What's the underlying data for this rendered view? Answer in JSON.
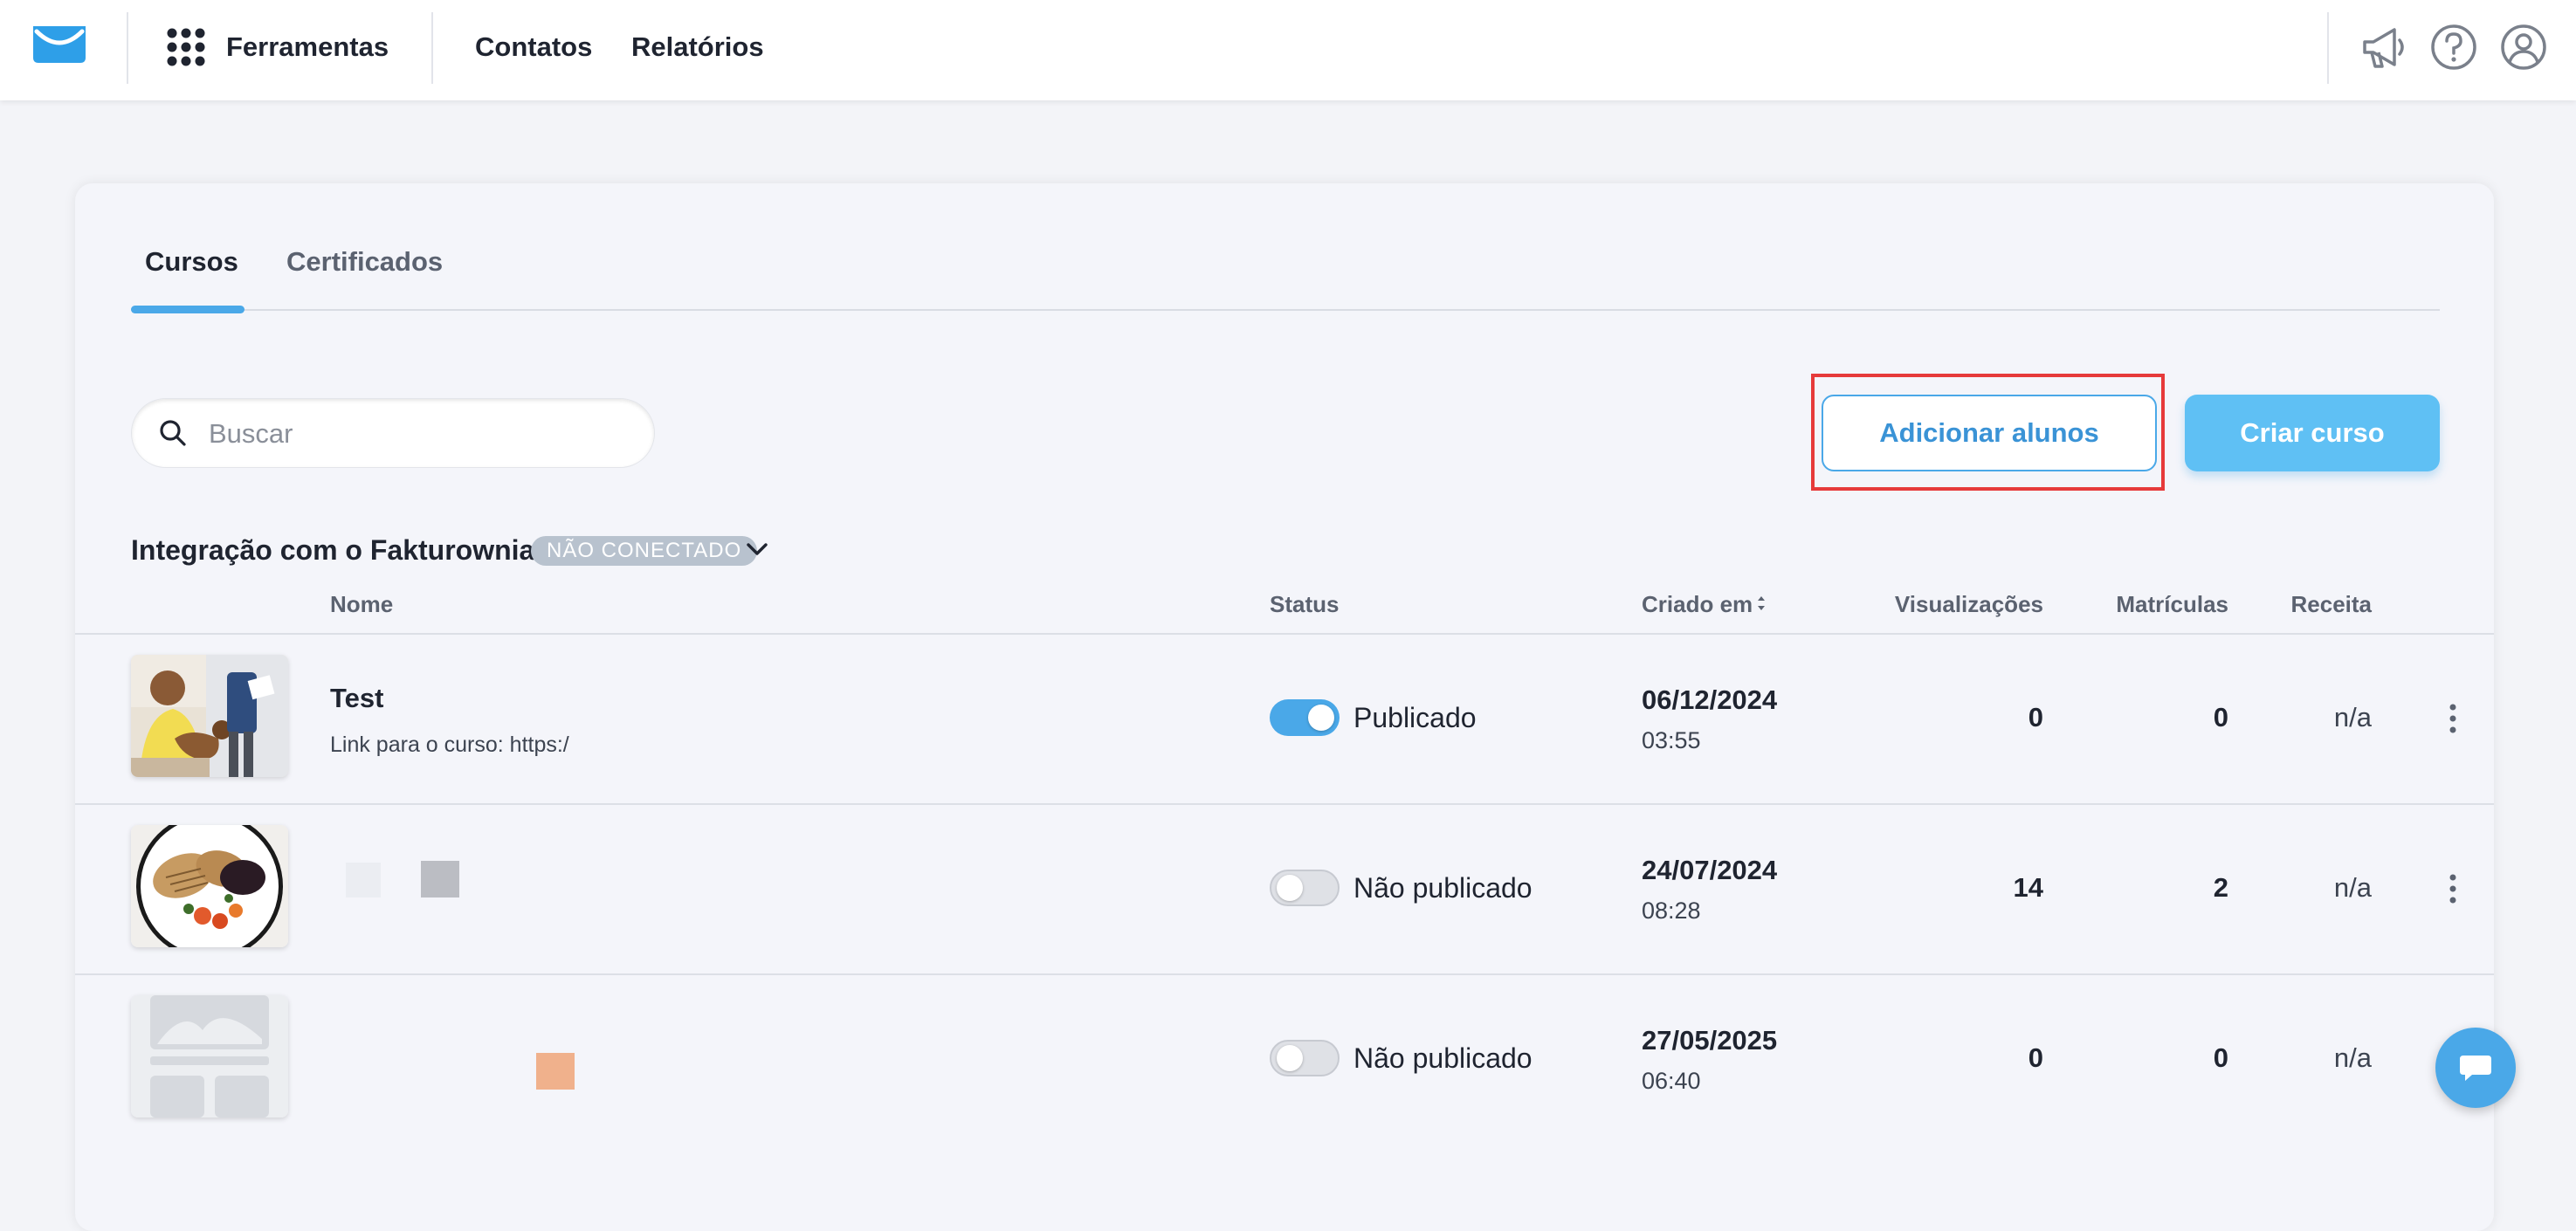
{
  "topbar": {
    "tools_label": "Ferramentas",
    "nav_items": [
      {
        "label": "Contatos"
      },
      {
        "label": "Relatórios"
      }
    ],
    "icons": [
      "megaphone-icon",
      "help-icon",
      "user-account-icon"
    ]
  },
  "tabs": [
    {
      "label": "Cursos",
      "active": true
    },
    {
      "label": "Certificados",
      "active": false
    }
  ],
  "search": {
    "placeholder": "Buscar",
    "value": ""
  },
  "actions": {
    "add_students_label": "Adicionar alunos",
    "create_course_label": "Criar curso"
  },
  "integration": {
    "label": "Integração com o Fakturownia",
    "status_badge": "NÃO CONECTADO"
  },
  "table": {
    "columns": {
      "name": "Nome",
      "status": "Status",
      "created": "Criado em",
      "views": "Visualizações",
      "enrollments": "Matrículas",
      "revenue": "Receita"
    },
    "rows": [
      {
        "title": "Test",
        "link_text": "Link para o curso: https:/",
        "published": true,
        "status": "Publicado",
        "date": "06/12/2024",
        "time": "03:55",
        "views": "0",
        "enrollments": "0",
        "revenue": "n/a"
      },
      {
        "title": "",
        "link_text": "",
        "published": false,
        "status": "Não publicado",
        "date": "24/07/2024",
        "time": "08:28",
        "views": "14",
        "enrollments": "2",
        "revenue": "n/a"
      },
      {
        "title": "",
        "link_text": "",
        "published": false,
        "status": "Não publicado",
        "date": "27/05/2025",
        "time": "06:40",
        "views": "0",
        "enrollments": "0",
        "revenue": "n/a"
      }
    ]
  },
  "colors": {
    "accent": "#4aa8e8",
    "primary_button": "#5fc0f4",
    "highlight_border": "#e63a3a",
    "badge": "#b8c2ce"
  }
}
